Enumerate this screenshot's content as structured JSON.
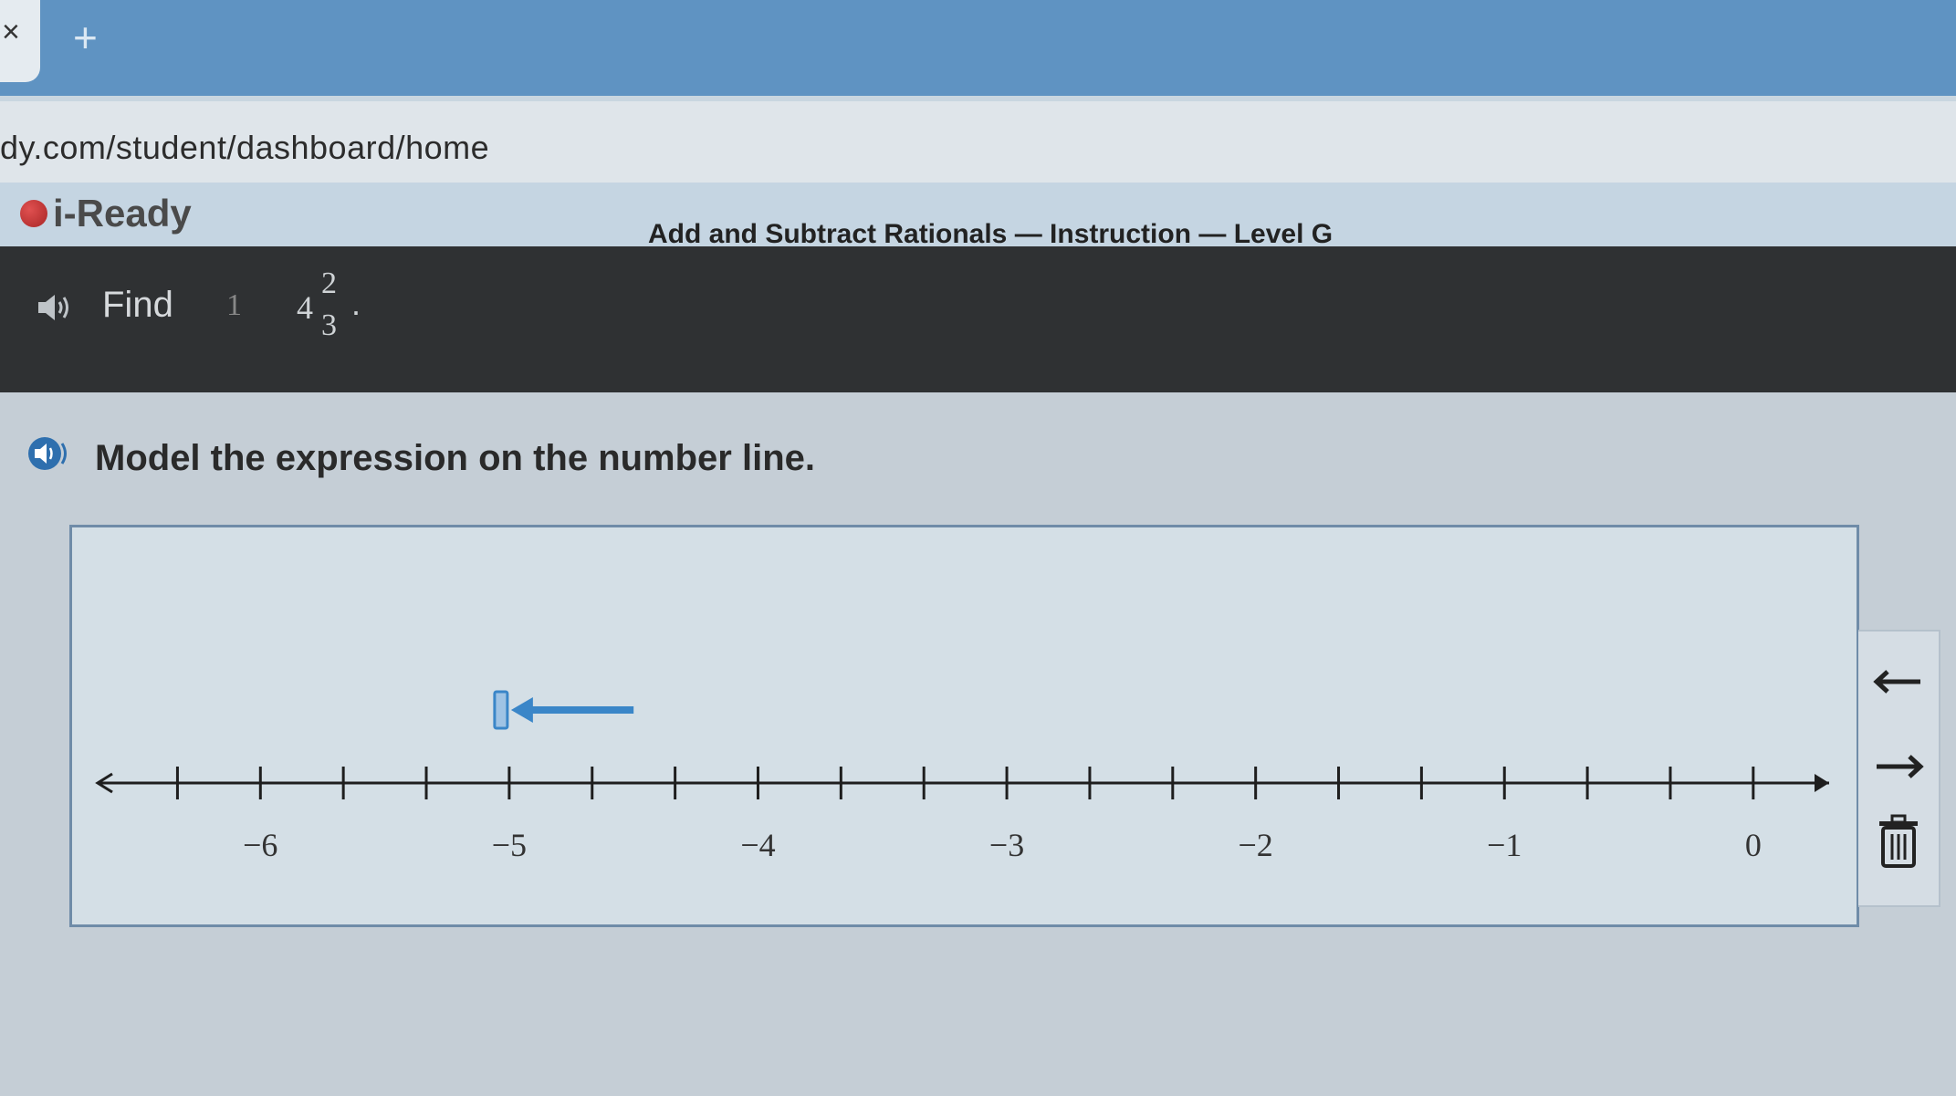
{
  "browser": {
    "new_tab_symbol": "+",
    "tab_close_symbol": "×",
    "url": "dy.com/student/dashboard/home"
  },
  "app": {
    "logo_text": "i-Ready",
    "lesson_title": "Add and Subtract Rationals — Instruction — Level G",
    "close_symbol": "×",
    "brand_color": "#c83232"
  },
  "prompt": {
    "find_label": "Find",
    "operand_1": "1",
    "whole": "4",
    "numerator": "2",
    "denominator": "3",
    "period": "."
  },
  "instruction": {
    "text": "Model the expression on the number line."
  },
  "number_line": {
    "min": -6.5,
    "max": 0.25,
    "tick_step": 0.3333,
    "labels": [
      "−6",
      "−5",
      "−4",
      "−3",
      "−2",
      "−1",
      "0"
    ],
    "label_values": [
      -6,
      -5,
      -4,
      -3,
      -2,
      -1,
      0
    ],
    "arrow_tool": {
      "direction": "left",
      "start_value": -4.5,
      "end_value": -5.0
    }
  },
  "tools": {
    "left_arrow_icon": "left-arrow-icon",
    "right_arrow_icon": "right-arrow-icon",
    "trash_icon": "trash-icon",
    "accent_color": "#3a86c8"
  }
}
